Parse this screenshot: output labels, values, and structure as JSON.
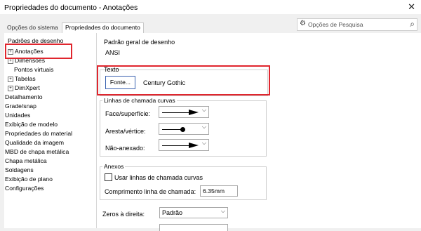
{
  "window": {
    "title": "Propriedades do documento - Anotações"
  },
  "tabs": [
    {
      "label": "Opções do sistema"
    },
    {
      "label": "Propriedades do documento"
    }
  ],
  "search": {
    "placeholder": "Opções de Pesquisa"
  },
  "tree": {
    "header": "Padrões de desenho",
    "items": [
      {
        "label": "Anotações"
      },
      {
        "label": "Dimensões"
      },
      {
        "label": "Pontos virtuais"
      },
      {
        "label": "Tabelas"
      },
      {
        "label": "DimXpert"
      },
      {
        "label": "Detalhamento"
      },
      {
        "label": "Grade/snap"
      },
      {
        "label": "Unidades"
      },
      {
        "label": "Exibição de modelo"
      },
      {
        "label": "Propriedades do material"
      },
      {
        "label": "Qualidade da imagem"
      },
      {
        "label": "MBD de chapa metálica"
      },
      {
        "label": "Chapa metálica"
      },
      {
        "label": "Soldagens"
      },
      {
        "label": "Exibição de plano"
      },
      {
        "label": "Configurações"
      }
    ]
  },
  "panel": {
    "standard_label": "Padrão geral de desenho",
    "standard_value": "ANSI",
    "text_group": "Texto",
    "font_button": "Fonte...",
    "font_name": "Century Gothic",
    "leader_group": "Linhas de chamada curvas",
    "face_label": "Face/superfície:",
    "edge_label": "Aresta/vértice:",
    "unattached_label": "Não-anexado:",
    "attach_group": "Anexos",
    "bent_leaders_label": "Usar linhas de chamada curvas",
    "leader_length_label": "Comprimento linha de chamada:",
    "leader_length_value": "6.35mm",
    "zeros_label": "Zeros à direita:",
    "zeros_value": "Padrão"
  },
  "colors": {
    "highlight": "#e0262e"
  }
}
